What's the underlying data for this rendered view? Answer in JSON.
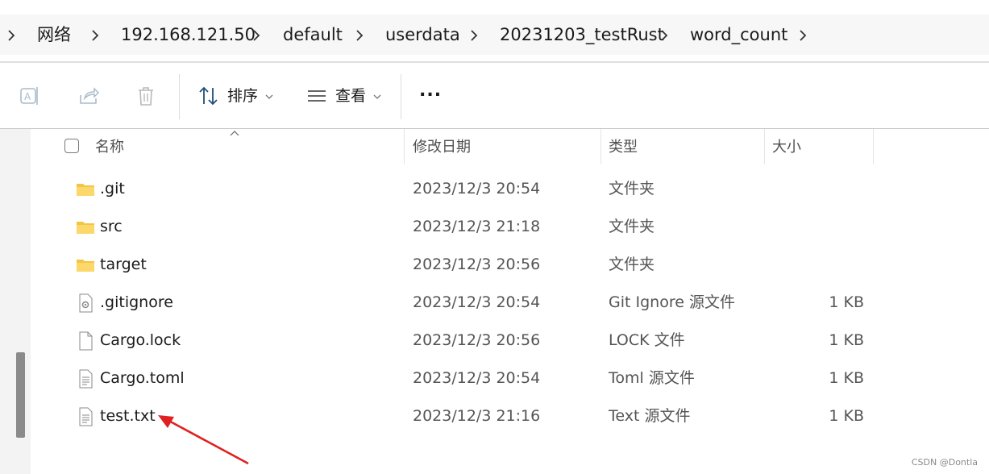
{
  "breadcrumb": {
    "items": [
      {
        "label": "网络"
      },
      {
        "label": "192.168.121.50"
      },
      {
        "label": "default"
      },
      {
        "label": "userdata"
      },
      {
        "label": "20231203_testRust"
      },
      {
        "label": "word_count"
      }
    ]
  },
  "toolbar": {
    "sort_label": "排序",
    "view_label": "查看",
    "more_label": "..."
  },
  "columns": {
    "name": "名称",
    "modified": "修改日期",
    "type": "类型",
    "size": "大小"
  },
  "files": [
    {
      "name": ".git",
      "modified": "2023/12/3 20:54",
      "type": "文件夹",
      "size": "",
      "icon": "folder-icon"
    },
    {
      "name": "src",
      "modified": "2023/12/3 21:18",
      "type": "文件夹",
      "size": "",
      "icon": "folder-icon"
    },
    {
      "name": "target",
      "modified": "2023/12/3 20:56",
      "type": "文件夹",
      "size": "",
      "icon": "folder-icon"
    },
    {
      "name": ".gitignore",
      "modified": "2023/12/3 20:54",
      "type": "Git Ignore 源文件",
      "size": "1 KB",
      "icon": "gear-file-icon"
    },
    {
      "name": "Cargo.lock",
      "modified": "2023/12/3 20:56",
      "type": "LOCK 文件",
      "size": "1 KB",
      "icon": "blank-file-icon"
    },
    {
      "name": "Cargo.toml",
      "modified": "2023/12/3 20:54",
      "type": "Toml 源文件",
      "size": "1 KB",
      "icon": "text-file-icon"
    },
    {
      "name": "test.txt",
      "modified": "2023/12/3 21:16",
      "type": "Text 源文件",
      "size": "1 KB",
      "icon": "text-file-icon"
    }
  ],
  "colors": {
    "folder": "#f4c542",
    "annotation_arrow": "#e02020",
    "scrollbar": "#8a8a8a"
  },
  "watermark": "CSDN @Dontla"
}
